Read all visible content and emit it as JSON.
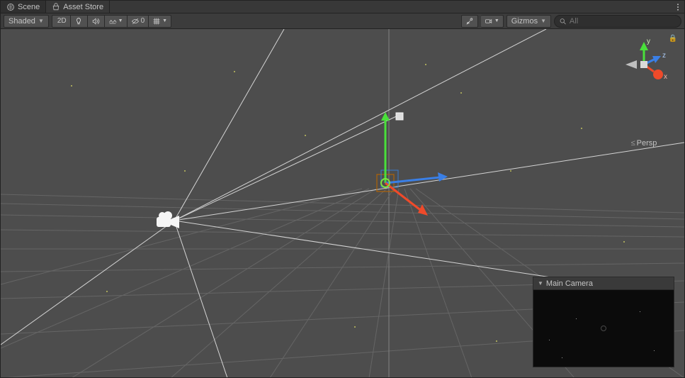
{
  "tabs": {
    "scene": "Scene",
    "asset_store": "Asset Store"
  },
  "toolbar": {
    "shading_mode": "Shaded",
    "mode_2d": "2D",
    "hidden_count": "0",
    "gizmos_label": "Gizmos",
    "search_placeholder": "All"
  },
  "gizmo": {
    "x_label": "x",
    "y_label": "y",
    "z_label": "z",
    "projection": "Persp"
  },
  "camera_preview": {
    "title": "Main Camera"
  }
}
